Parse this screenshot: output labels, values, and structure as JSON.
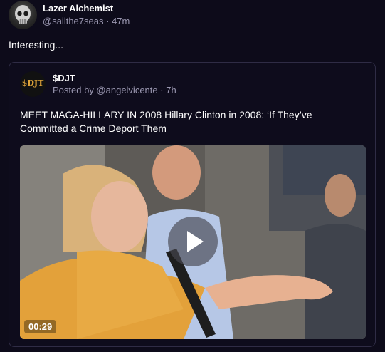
{
  "post": {
    "author_name": "Lazer Alchemist",
    "author_handle": "@sailthe7seas",
    "separator": "·",
    "time": "47m",
    "text": "Interesting..."
  },
  "quote": {
    "avatar_text": "$DJT",
    "name": "$DJT",
    "posted_by": "Posted by @angelvicente",
    "separator": "·",
    "time": "7h",
    "title": "MEET MAGA-HILLARY IN 2008 Hillary Clinton in 2008: ‘If They’ve Committed a Crime Deport Them"
  },
  "video": {
    "duration": "00:29",
    "play_icon": "play-icon",
    "colors": {
      "jacket": "#e3a13a",
      "shirt": "#b6c7e6",
      "background": "#6d6a64"
    }
  },
  "colors": {
    "page_bg": "#0d0b1a",
    "muted_text": "#9a97b0",
    "card_border": "#2f2c45"
  }
}
